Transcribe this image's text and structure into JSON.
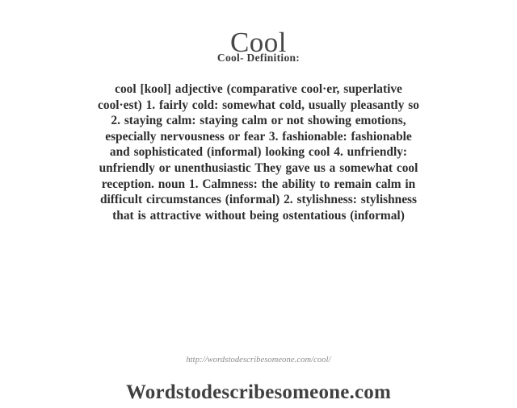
{
  "header": {
    "word_title": "Cool",
    "definition_label": "Cool- Definition:"
  },
  "definition": {
    "full_text": "cool [kool] adjective (comparative cool·er, superlative cool·est) 1. fairly cold: somewhat cold, usually pleasantly so 2. staying calm: staying calm or not showing emotions, especially nervousness or fear 3. fashionable: fashionable and sophisticated (informal) looking cool 4. unfriendly: unfriendly or unenthusiastic They gave us a somewhat cool reception. noun 1. Calmness: the ability to remain calm in difficult circumstances (informal) 2. stylishness: stylishness that is attractive without being ostentatious (informal)",
    "headword": "cool",
    "pronunciation": "[kool]",
    "lines": [
      "cool  [kool]  adjective  (comparative  cool·er, superlative",
      "cool·est)  1. fairly cold:  somewhat   cold, usually pleasantly  so",
      "2. staying  calm: staying  calm or not  showing  emotions,",
      "especially  nervousness   or fear 3. fashionable:  fashionable",
      "and  sophisticated   (informal)  looking  cool  4. unfriendly:",
      "unfriendly  or unenthusiastic  They gave  us a somewhat   cool",
      "reception.  noun  1. Calmness:  the  ability  to remain  calm in",
      "difficult  circumstances  (informal)  2. stylishness:  stylishness",
      "that  is attractive  without  being  ostentatious   (informal)"
    ]
  },
  "footer": {
    "source_url": "http://wordstodescribesomeone.com/cool/",
    "site_name": "Wordstodescribesomeone.com"
  },
  "colors": {
    "background": "#ffffff",
    "title_text": "#474747",
    "body_text": "#2e2e2e",
    "url_text": "#8a8a8a",
    "site_name_text": "#404040"
  }
}
